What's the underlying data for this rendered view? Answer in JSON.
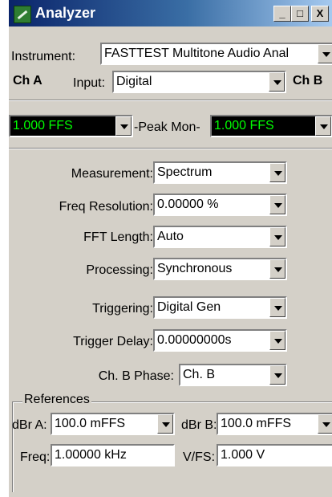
{
  "window": {
    "title": "Analyzer",
    "buttons": {
      "minimize": "_",
      "maximize": "□",
      "close": "X"
    }
  },
  "instrument": {
    "label": "Instrument:",
    "value": "FASTTEST Multitone Audio Anal"
  },
  "channel_a": {
    "label": "Ch A"
  },
  "channel_b": {
    "label": "Ch B"
  },
  "input": {
    "label": "Input:",
    "value": "Digital"
  },
  "ch_a_level": {
    "value": "1.000   FFS"
  },
  "peak_mon": {
    "label": "-Peak Mon-",
    "value": "1.000   FFS"
  },
  "settings": {
    "measurement": {
      "label": "Measurement:",
      "value": "Spectrum"
    },
    "freq_resolution": {
      "label": "Freq Resolution:",
      "value": "0.00000  %"
    },
    "fft_length": {
      "label": "FFT Length:",
      "value": "Auto"
    },
    "processing": {
      "label": "Processing:",
      "value": "Synchronous"
    },
    "triggering": {
      "label": "Triggering:",
      "value": "Digital Gen"
    },
    "trigger_delay": {
      "label": "Trigger Delay:",
      "value": "0.00000000s"
    },
    "ch_b_phase": {
      "label": "Ch. B Phase:",
      "value": "Ch. B"
    }
  },
  "references": {
    "title": "References",
    "dbr_a": {
      "label": "dBr A:",
      "value": "100.0   mFFS"
    },
    "dbr_b": {
      "label": "dBr B:",
      "value": "100.0   mFFS"
    },
    "freq": {
      "label": "Freq:",
      "value": "1.00000 kHz"
    },
    "vfs": {
      "label": "V/FS:",
      "value": "1.000    V"
    }
  }
}
